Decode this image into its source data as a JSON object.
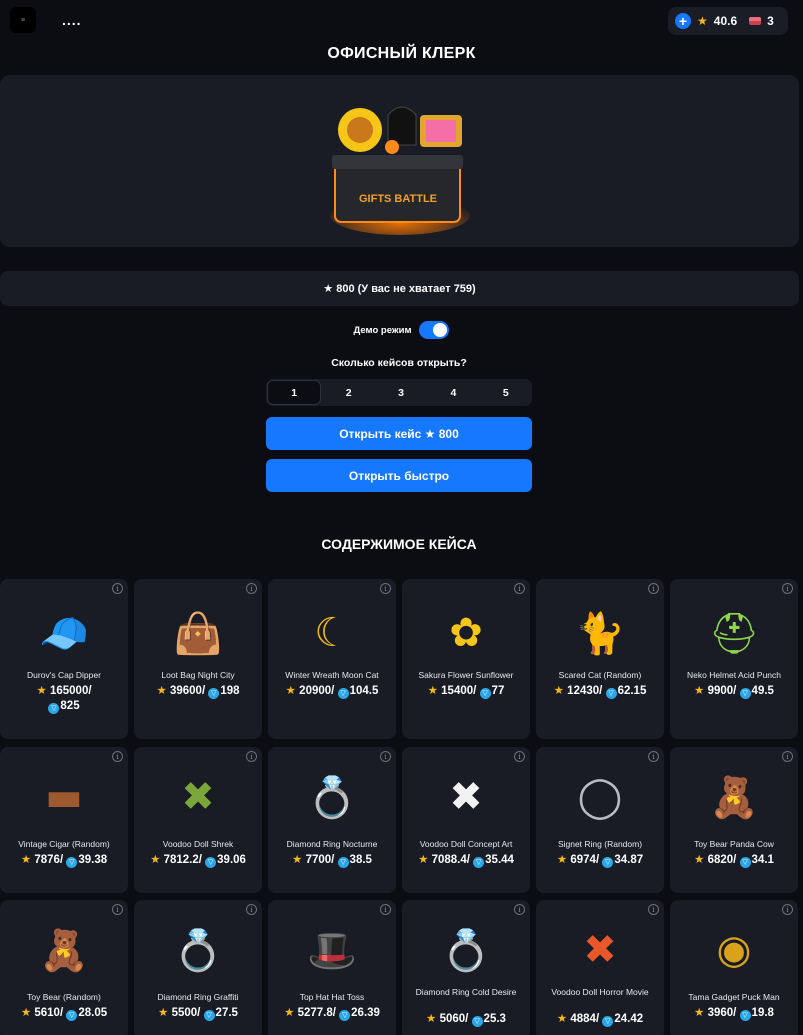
{
  "header": {
    "logo_text": "≡",
    "username": "....",
    "plus": "+",
    "stars_balance": "40.6",
    "tickets_balance": "3"
  },
  "case": {
    "title": "ОФИСНЫЙ КЛЕРК",
    "image_label": "GIFTS BATTLE",
    "price_star": "★",
    "price_text": "800 (У вас не хватает 759)"
  },
  "controls": {
    "demo_label": "Демо режим",
    "demo_enabled": true,
    "how_many_label": "Сколько кейсов открыть?",
    "counts": [
      "1",
      "2",
      "3",
      "4",
      "5"
    ],
    "selected_count": "1",
    "open_button": "Открыть кейс ★ 800",
    "open_fast_button": "Открыть быстро"
  },
  "contents": {
    "title": "СОДЕРЖИМОЕ КЕЙСА",
    "info_icon": "i",
    "ton_icon": "▽",
    "items": [
      {
        "name": "Durov's Cap Dipper",
        "stars": "165000/",
        "ton": "825",
        "icon": "cap-icon",
        "color": "#2b7fe0"
      },
      {
        "name": "Loot Bag Night City",
        "stars": "39600/",
        "ton": "198",
        "icon": "bag-icon",
        "color": "#2a2a2a"
      },
      {
        "name": "Winter Wreath Moon Cat",
        "stars": "20900/",
        "ton": "104.5",
        "icon": "moon-icon",
        "color": "#f0b91c"
      },
      {
        "name": "Sakura Flower Sunflower",
        "stars": "15400/",
        "ton": "77",
        "icon": "sunflower-icon",
        "color": "#f5c518"
      },
      {
        "name": "Scared Cat (Random)",
        "stars": "12430/",
        "ton": "62.15",
        "icon": "cat-icon",
        "color": "#e94fd0"
      },
      {
        "name": "Neko Helmet Acid Punch",
        "stars": "9900/",
        "ton": "49.5",
        "icon": "helmet-icon",
        "color": "#8fd64a"
      },
      {
        "name": "Vintage Cigar (Random)",
        "stars": "7876/",
        "ton": "39.38",
        "icon": "cigar-icon",
        "color": "#9c5a2e"
      },
      {
        "name": "Voodoo Doll Shrek",
        "stars": "7812.2/",
        "ton": "39.06",
        "icon": "doll-icon",
        "color": "#7aa63a"
      },
      {
        "name": "Diamond Ring Nocturne",
        "stars": "7700/",
        "ton": "38.5",
        "icon": "ring-box-icon",
        "color": "#c9202a"
      },
      {
        "name": "Voodoo Doll Concept Art",
        "stars": "7088.4/",
        "ton": "35.44",
        "icon": "doll-icon",
        "color": "#f2f2f2"
      },
      {
        "name": "Signet Ring (Random)",
        "stars": "6974/",
        "ton": "34.87",
        "icon": "ring-icon",
        "color": "#b8bcc4"
      },
      {
        "name": "Toy Bear Panda Cow",
        "stars": "6820/",
        "ton": "34.1",
        "icon": "bear-icon",
        "color": "#f4f4f4"
      },
      {
        "name": "Toy Bear (Random)",
        "stars": "5610/",
        "ton": "28.05",
        "icon": "bear-icon",
        "color": "#f0f0f0"
      },
      {
        "name": "Diamond Ring Graffiti",
        "stars": "5500/",
        "ton": "27.5",
        "icon": "ring-box-icon",
        "color": "#7fe04a"
      },
      {
        "name": "Top Hat Hat Toss",
        "stars": "5277.8/",
        "ton": "26.39",
        "icon": "top-hat-icon",
        "color": "#d9a82a"
      },
      {
        "name": "Diamond Ring Cold Desire",
        "stars": "5060/",
        "ton": "25.3",
        "icon": "ring-box-icon",
        "color": "#1d57d8"
      },
      {
        "name": "Voodoo Doll Horror Movie",
        "stars": "4884/",
        "ton": "24.42",
        "icon": "doll-icon",
        "color": "#e8582a"
      },
      {
        "name": "Tama Gadget Puck Man",
        "stars": "3960/",
        "ton": "19.8",
        "icon": "gadget-icon",
        "color": "#d9a21a"
      }
    ]
  }
}
